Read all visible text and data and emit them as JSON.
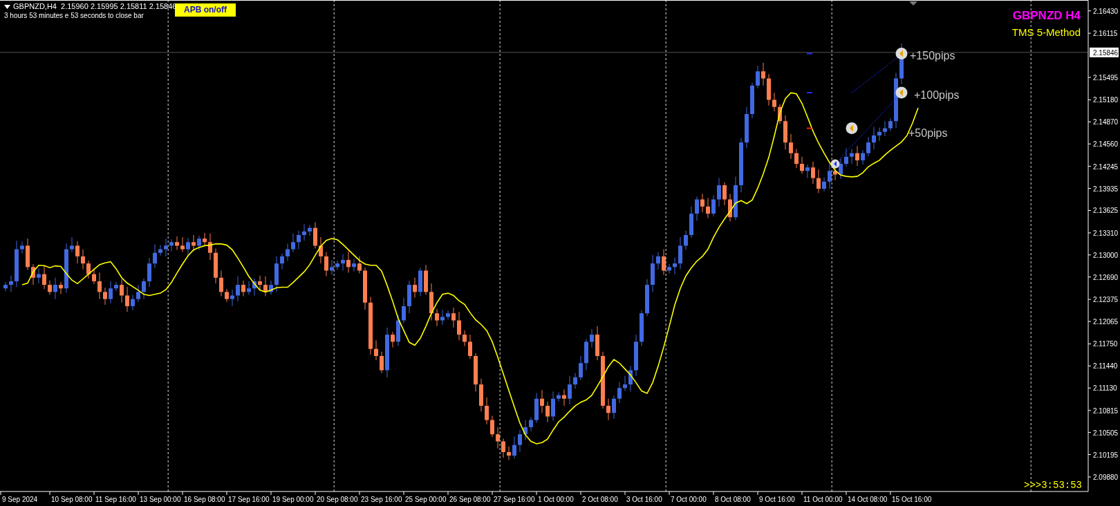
{
  "header": {
    "symbol_line": "GBPNZD,H4  2.15960 2.15995 2.15811 2.15846",
    "countdown_line": "3 hours 53 minutes e 53 seconds to close bar"
  },
  "apb_button": {
    "label": "APB on/off"
  },
  "title": {
    "symbol": "GBPNZD H4",
    "method": "TMS 5-Method"
  },
  "countdown": ">>>3:53:53",
  "current_price": "2.15846",
  "targets": [
    "+150pips",
    "+100pips",
    "+50pips"
  ],
  "price_axis": [
    "2.16430",
    "2.16115",
    "2.15495",
    "2.15180",
    "2.14870",
    "2.14560",
    "2.14245",
    "2.13935",
    "2.13625",
    "2.13310",
    "2.13000",
    "2.12690",
    "2.12375",
    "2.12065",
    "2.11750",
    "2.11440",
    "2.11130",
    "2.10815",
    "2.10505",
    "2.10195",
    "2.09880"
  ],
  "time_axis": [
    "9 Sep 2024",
    "10 Sep 08:00",
    "11 Sep 16:00",
    "13 Sep 00:00",
    "16 Sep 08:00",
    "17 Sep 16:00",
    "19 Sep 00:00",
    "20 Sep 08:00",
    "23 Sep 16:00",
    "25 Sep 00:00",
    "26 Sep 08:00",
    "27 Sep 16:00",
    "1 Oct 00:00",
    "2 Oct 08:00",
    "3 Oct 16:00",
    "7 Oct 00:00",
    "8 Oct 08:00",
    "9 Oct 16:00",
    "11 Oct 00:00",
    "14 Oct 08:00",
    "15 Oct 16:00"
  ]
}
